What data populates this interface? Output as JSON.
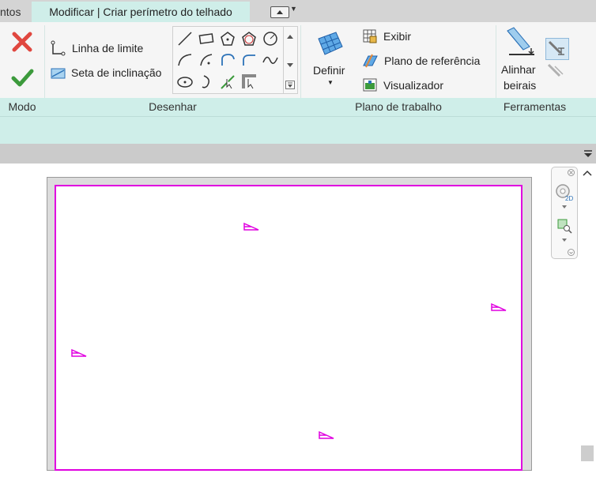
{
  "tabs": {
    "previous_partial": "ntos",
    "active": "Modificar | Criar perímetro do telhado"
  },
  "ribbon": {
    "modo": {
      "title": "Modo",
      "cancel_icon": "x-cancel-icon",
      "finish_icon": "checkmark-finish-icon"
    },
    "desenhar": {
      "title": "Desenhar",
      "boundary_line_label": "Linha de limite",
      "slope_arrow_label": "Seta de inclinação",
      "tools": [
        "line-icon",
        "rectangle-icon",
        "inscribed-polygon-icon",
        "circumscribed-polygon-icon",
        "circle-icon",
        "start-end-radius-arc-icon",
        "center-ends-arc-icon",
        "tangent-end-arc-icon",
        "fillet-arc-icon",
        "spline-icon",
        "ellipse-icon",
        "partial-ellipse-icon",
        "pick-lines-icon",
        "pick-walls-icon"
      ]
    },
    "plano_de_trabalho": {
      "title": "Plano de trabalho",
      "definir_label": "Definir",
      "exibir_label": "Exibir",
      "plano_ref_label": "Plano de  referência",
      "visualizador_label": "Visualizador"
    },
    "ferramentas": {
      "title": "Ferramentas",
      "alinhar_label_line1": "Alinhar",
      "alinhar_label_line2": "beirais"
    }
  },
  "colors": {
    "accent_panel": "#cfeee9",
    "sketch_line": "#e000e0",
    "cancel": "#e0473f",
    "finish": "#3c9a3c"
  }
}
